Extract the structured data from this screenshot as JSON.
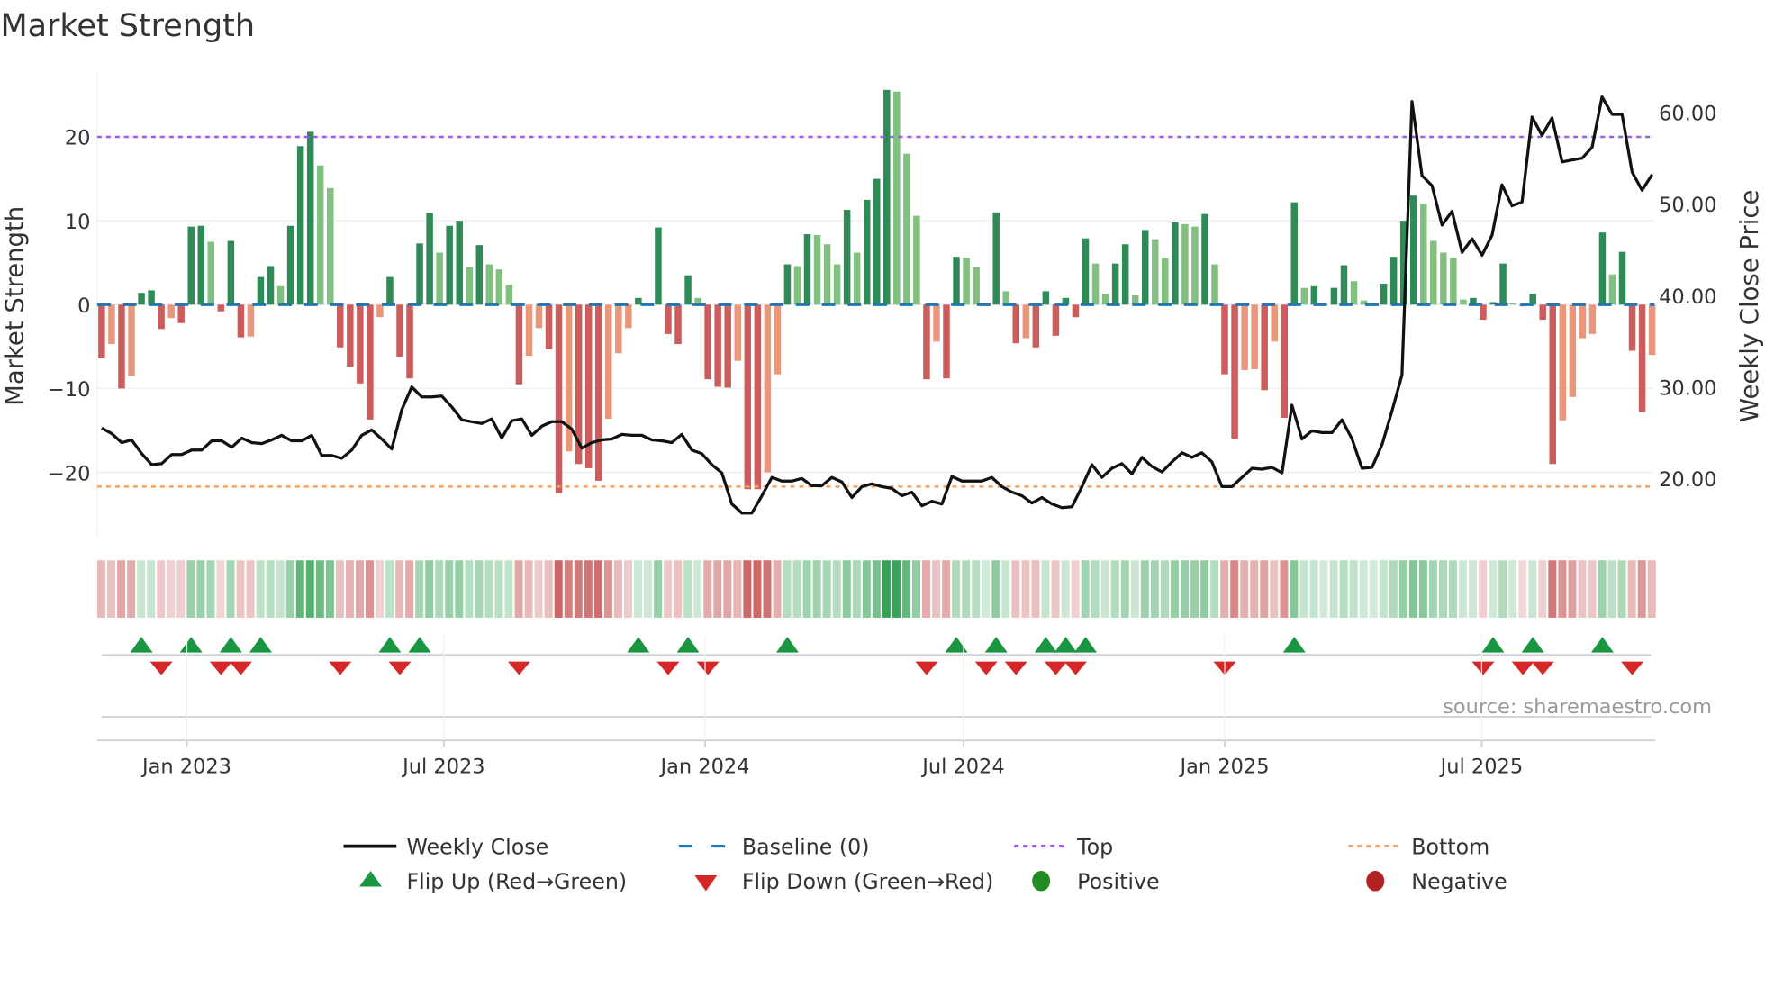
{
  "title": "Market Strength",
  "source": "source: sharemaestro.com",
  "chart_data": {
    "type": "bar",
    "title": "Market Strength",
    "ylabel": "Market Strength",
    "y2label": "Weekly Close Price",
    "xlabel": "",
    "start_date": "2022-11-02",
    "frequency": "weekly",
    "ylim": [
      -27.8,
      27.6
    ],
    "y2lim": [
      13.5,
      64.3
    ],
    "yticks": [
      {
        "v": 20,
        "label": "20"
      },
      {
        "v": 10,
        "label": "10"
      },
      {
        "v": 0,
        "label": "0"
      },
      {
        "v": -10,
        "label": "−10"
      },
      {
        "v": -20,
        "label": "−20"
      }
    ],
    "y2ticks": [
      {
        "v": 60,
        "label": "60.00"
      },
      {
        "v": 50,
        "label": "50.00"
      },
      {
        "v": 40,
        "label": "40.00"
      },
      {
        "v": 30,
        "label": "30.00"
      },
      {
        "v": 20,
        "label": "20.00"
      }
    ],
    "xticks": [
      {
        "date": "2023-01-01",
        "label": "Jan 2023"
      },
      {
        "date": "2023-07-01",
        "label": "Jul 2023"
      },
      {
        "date": "2024-01-01",
        "label": "Jan 2024"
      },
      {
        "date": "2024-07-01",
        "label": "Jul 2024"
      },
      {
        "date": "2025-01-01",
        "label": "Jan 2025"
      },
      {
        "date": "2025-07-01",
        "label": "Jul 2025"
      }
    ],
    "top_level": 20,
    "bottom_level": -21.7,
    "baseline": 0,
    "strength": [
      -6.4,
      -4.7,
      -10,
      -8.5,
      1.4,
      1.7,
      -2.9,
      -1.6,
      -2.2,
      9.3,
      9.4,
      7.5,
      -0.8,
      7.6,
      -3.9,
      -3.8,
      3.3,
      4.6,
      2.2,
      9.4,
      18.9,
      20.6,
      16.6,
      13.9,
      -5.1,
      -7.4,
      -9.4,
      -13.7,
      -1.5,
      3.3,
      -6.2,
      -8.8,
      7.3,
      10.9,
      6.2,
      9.4,
      10,
      4.5,
      7.1,
      4.8,
      4.2,
      2.4,
      -9.5,
      -6.1,
      -2.8,
      -5.3,
      -22.5,
      -17.5,
      -19,
      -19.5,
      -21,
      -13.6,
      -5.8,
      -2.8,
      0.8,
      0.2,
      9.2,
      -3.5,
      -4.7,
      3.5,
      0.8,
      -8.9,
      -9.8,
      -9.9,
      -6.7,
      -22,
      -22,
      -20,
      -8.3,
      4.8,
      4.6,
      8.4,
      8.3,
      7.2,
      4.8,
      11.3,
      6.2,
      12.5,
      15,
      25.6,
      25.4,
      18,
      10.6,
      -8.9,
      -4.4,
      -8.8,
      5.7,
      5.6,
      4.5,
      0,
      11,
      1.6,
      -4.6,
      -4,
      -5.1,
      1.6,
      -3.7,
      0.8,
      -1.5,
      7.9,
      4.9,
      1.3,
      4.9,
      7.2,
      1.1,
      8.9,
      7.8,
      5.5,
      9.8,
      9.6,
      9.3,
      10.8,
      4.8,
      -8.3,
      -16,
      -7.8,
      -7.7,
      -10.2,
      -4.4,
      -13.5,
      12.2,
      2,
      2.2,
      0,
      2,
      4.7,
      2.8,
      0.5,
      0,
      2.5,
      5.7,
      10,
      13,
      12,
      7.6,
      6.2,
      5.6,
      0.6,
      0.8,
      -1.8,
      0.3,
      4.9,
      0.2,
      -0.2,
      1.3,
      -1.8,
      -19,
      -13.8,
      -11,
      -4,
      -3.5,
      8.6,
      3.6,
      6.3,
      -5.5,
      -12.8,
      -6
    ],
    "weekly_close": [
      25.5,
      24.9,
      23.9,
      24.2,
      22.7,
      21.5,
      21.6,
      22.6,
      22.6,
      23.1,
      23.1,
      24.1,
      24.1,
      23.4,
      24.4,
      23.9,
      23.8,
      24.2,
      24.7,
      24.1,
      24.1,
      24.7,
      22.5,
      22.5,
      22.2,
      23.1,
      24.7,
      25.3,
      24.3,
      23.2,
      27.5,
      30.0,
      28.9,
      28.9,
      29.0,
      27.8,
      26.4,
      26.2,
      26.0,
      26.5,
      24.4,
      26.3,
      26.5,
      24.7,
      25.7,
      26.2,
      26.2,
      25.4,
      23.3,
      23.9,
      24.2,
      24.3,
      24.8,
      24.7,
      24.7,
      24.2,
      24.1,
      23.9,
      24.8,
      23.1,
      22.7,
      21.5,
      20.6,
      17.2,
      16.2,
      16.2,
      18.1,
      20.1,
      19.7,
      19.7,
      20.0,
      19.2,
      19.2,
      20.1,
      19.6,
      17.9,
      19.1,
      19.4,
      19.1,
      18.9,
      18.1,
      18.5,
      17.0,
      17.5,
      17.2,
      20.2,
      19.7,
      19.7,
      19.7,
      20.1,
      19.1,
      18.5,
      18.1,
      17.3,
      17.9,
      17.2,
      16.8,
      16.9,
      19.1,
      21.5,
      20.1,
      21.1,
      21.6,
      20.5,
      22.3,
      21.3,
      20.7,
      21.8,
      22.8,
      22.3,
      22.8,
      21.8,
      19.1,
      19.1,
      20.1,
      21.1,
      21.0,
      21.2,
      20.6,
      28.0,
      24.3,
      25.2,
      25.0,
      25.0,
      26.4,
      24.3,
      21.1,
      21.2,
      23.7,
      27.4,
      31.3,
      61.2,
      53.1,
      52.0,
      47.7,
      49.2,
      44.7,
      46.2,
      44.4,
      46.6,
      52.1,
      49.8,
      50.2,
      59.5,
      57.5,
      59.4,
      54.6,
      54.8,
      55.0,
      56.2,
      61.7,
      59.8,
      59.8,
      53.5,
      51.5,
      53.2
    ],
    "flip_up_weeks": [
      4,
      9,
      13,
      16,
      29,
      32,
      54,
      59,
      69,
      86,
      90,
      95,
      97,
      99,
      120,
      140,
      144,
      151
    ],
    "flip_down_weeks": [
      6,
      12,
      14,
      24,
      30,
      42,
      57,
      61,
      83,
      89,
      92,
      96,
      98,
      113,
      139,
      143,
      145,
      154
    ],
    "legend_placement": "bottom",
    "legend": [
      {
        "label": "Weekly Close",
        "kind": "line",
        "color": "#111111"
      },
      {
        "label": "Baseline (0)",
        "kind": "dash",
        "color": "#1f77b4"
      },
      {
        "label": "Top",
        "kind": "dot",
        "color": "#9b5de5"
      },
      {
        "label": "Bottom",
        "kind": "dot",
        "color": "#f4a261"
      },
      {
        "label": "Flip Up (Red→Green)",
        "kind": "tri-up",
        "color": "#1a9641"
      },
      {
        "label": "Flip Down (Green→Red)",
        "kind": "tri-down",
        "color": "#d62728"
      },
      {
        "label": "Positive",
        "kind": "circle",
        "color": "#228b22"
      },
      {
        "label": "Negative",
        "kind": "circle",
        "color": "#b22222"
      }
    ],
    "colors": {
      "up_strong": "#2e8b57",
      "up_weak": "#82c07f",
      "down_strong": "#cd5c5c",
      "down_weak": "#e9967a",
      "top": "#9b5de5",
      "bottom": "#f4a261",
      "baseline": "#1f77b4",
      "close": "#111111"
    }
  }
}
